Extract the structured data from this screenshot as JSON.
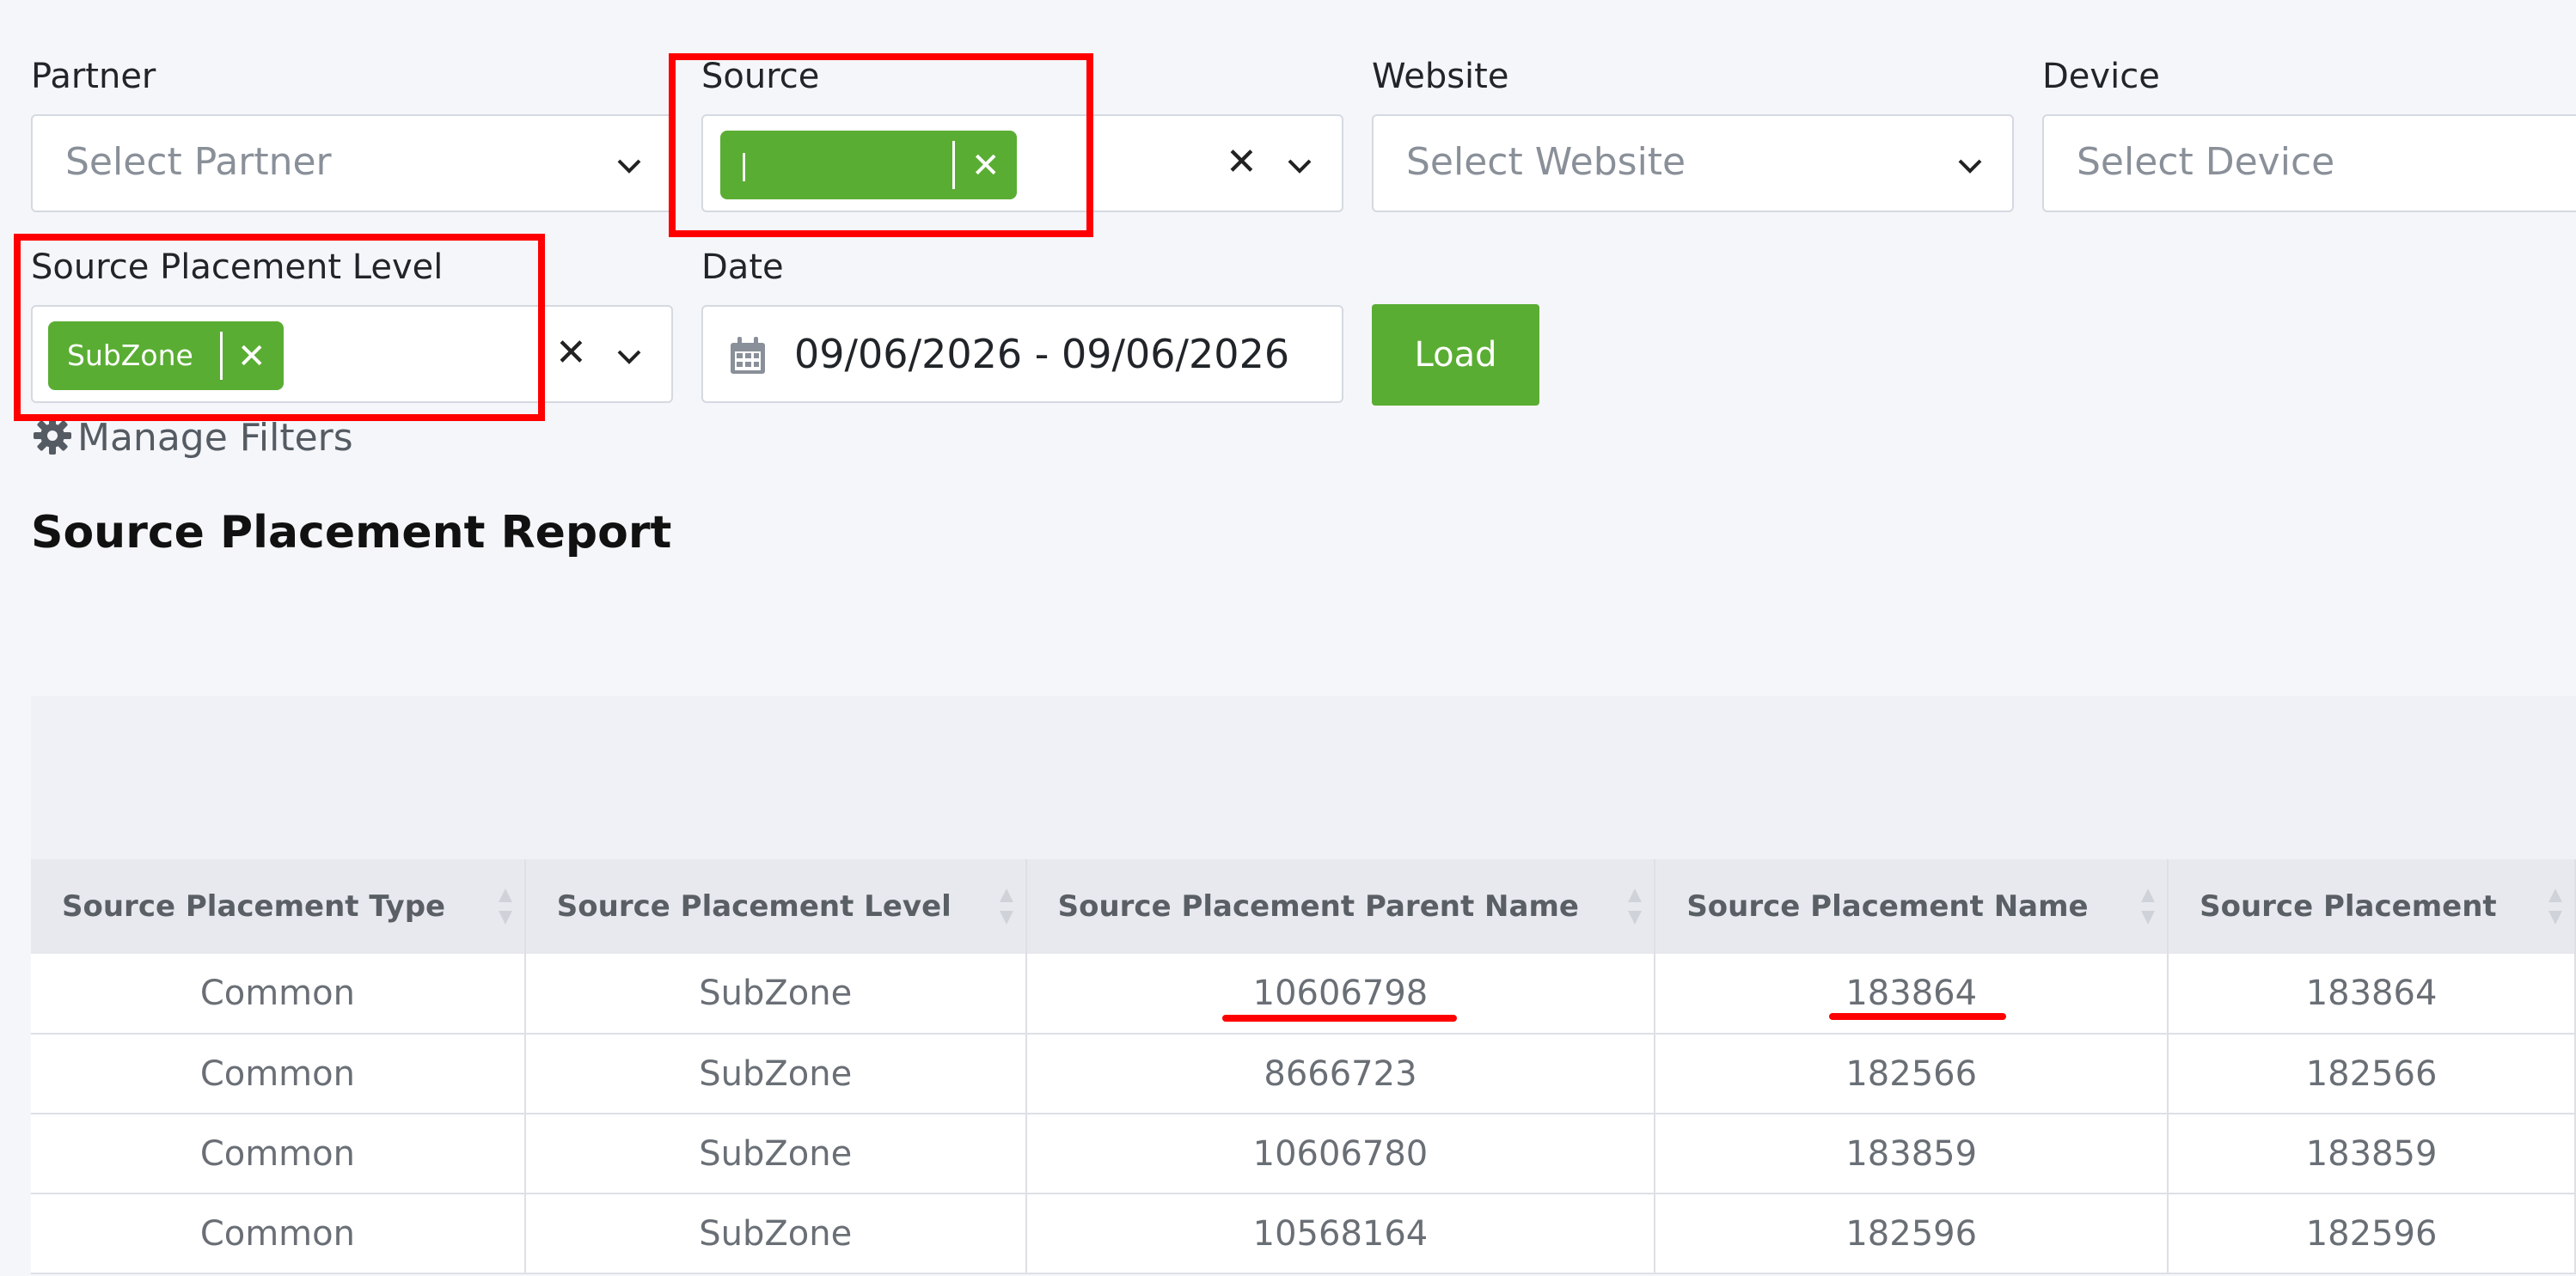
{
  "filters": {
    "partner": {
      "label": "Partner",
      "placeholder": "Select Partner"
    },
    "source": {
      "label": "Source",
      "tag_value": "|"
    },
    "website": {
      "label": "Website",
      "placeholder": "Select Website"
    },
    "device": {
      "label": "Device",
      "placeholder": "Select Device"
    },
    "placement_level": {
      "label": "Source Placement Level",
      "tag_value": "SubZone"
    },
    "date": {
      "label": "Date",
      "value": "09/06/2026 - 09/06/2026"
    },
    "load_label": "Load",
    "manage_label": "Manage Filters"
  },
  "report": {
    "title": "Source Placement Report",
    "columns": [
      "Source Placement Type",
      "Source Placement Level",
      "Source Placement Parent Name",
      "Source Placement Name",
      "Source Placement"
    ],
    "rows": [
      [
        "Common",
        "SubZone",
        "10606798",
        "183864",
        "183864"
      ],
      [
        "Common",
        "SubZone",
        "8666723",
        "182566",
        "182566"
      ],
      [
        "Common",
        "SubZone",
        "10606780",
        "183859",
        "183859"
      ],
      [
        "Common",
        "SubZone",
        "10568164",
        "182596",
        "182596"
      ]
    ]
  },
  "colors": {
    "accent": "#5aad33",
    "annotation": "#ff0000"
  },
  "icons": {
    "chevron": "chevron-down-icon",
    "clear": "close-icon",
    "calendar": "calendar-icon",
    "gear": "gear-icon",
    "sort": "sort-icon"
  }
}
